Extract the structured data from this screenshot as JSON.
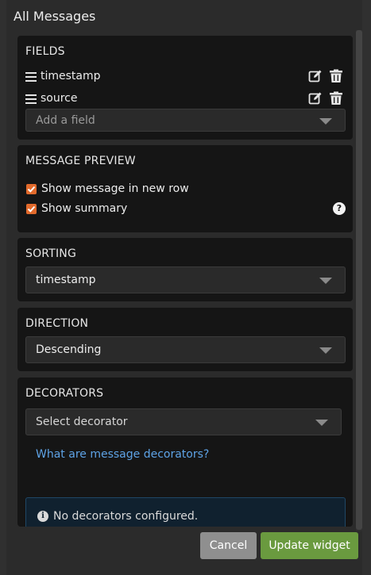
{
  "window": {
    "title": "All Messages"
  },
  "fields": {
    "title": "FIELDS",
    "items": [
      {
        "label": "timestamp"
      },
      {
        "label": "source"
      }
    ],
    "add_placeholder": "Add a field"
  },
  "preview": {
    "title": "MESSAGE PREVIEW",
    "options": [
      {
        "label": "Show message in new row",
        "checked": true
      },
      {
        "label": "Show summary",
        "checked": true
      }
    ],
    "help_glyph": "?"
  },
  "sorting": {
    "title": "SORTING",
    "value": "timestamp"
  },
  "direction": {
    "title": "DIRECTION",
    "value": "Descending"
  },
  "decorators": {
    "title": "DECORATORS",
    "select_placeholder": "Select decorator",
    "help_link": "What are message decorators?",
    "empty_notice": "No decorators configured.",
    "info_glyph": "i"
  },
  "actions": {
    "cancel": "Cancel",
    "update": "Update widget"
  },
  "colors": {
    "accent_checkbox": "#e26a2c",
    "link": "#5ea3e6",
    "update_button": "#6a9a3f",
    "cancel_button": "#8f8f8f"
  }
}
